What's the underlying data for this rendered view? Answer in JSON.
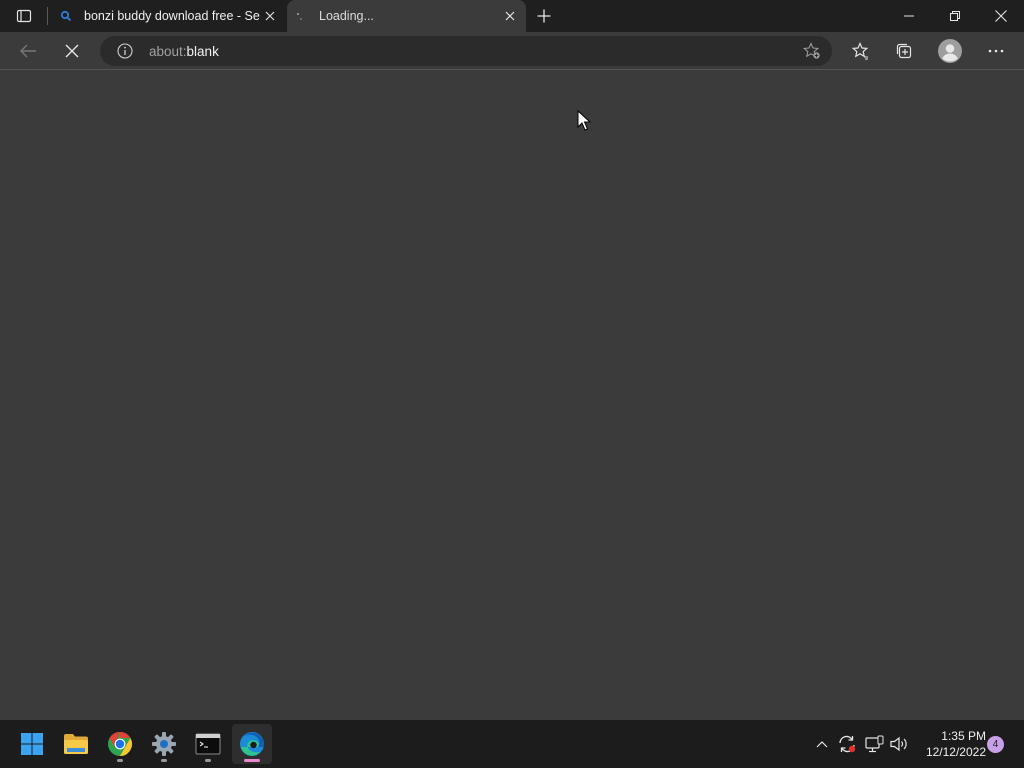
{
  "browser": {
    "tabs": [
      {
        "label": "bonzi buddy download free - Search",
        "active": false
      },
      {
        "label": "Loading...",
        "active": true
      }
    ],
    "address": {
      "scheme": "about:",
      "path": "blank"
    }
  },
  "taskbar": {
    "apps": [
      "start-icon",
      "file-explorer-icon",
      "chrome-icon",
      "settings-icon",
      "terminal-icon",
      "edge-icon"
    ],
    "clock": {
      "time": "1:35 PM",
      "date": "12/12/2022"
    },
    "notification_count": "4"
  },
  "colors": {
    "titlebar": "#1f1f1f",
    "page": "#3b3b3b",
    "taskbar": "#1c1c1c",
    "edge_indicator": "#e88ad1",
    "search_accent": "#2f7dd6"
  }
}
